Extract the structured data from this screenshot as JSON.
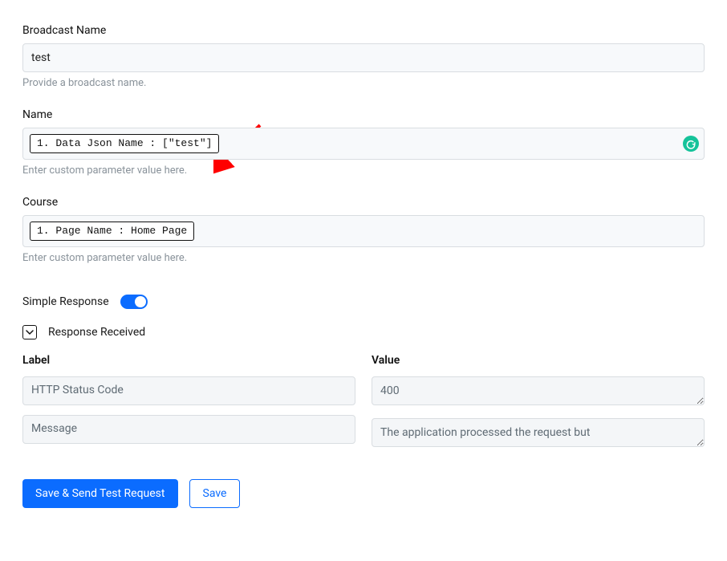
{
  "broadcast": {
    "label": "Broadcast Name",
    "value": "test",
    "help": "Provide a broadcast name."
  },
  "nameField": {
    "label": "Name",
    "tag": "1. Data Json Name : [\"test\"]",
    "help": "Enter custom parameter value here."
  },
  "courseField": {
    "label": "Course",
    "tag": "1. Page Name : Home Page",
    "help": "Enter custom parameter value here."
  },
  "simpleResponse": {
    "label": "Simple Response",
    "toggle_on": true,
    "responseReceived": "Response Received"
  },
  "table": {
    "labelHeader": "Label",
    "valueHeader": "Value",
    "rows": [
      {
        "label": "HTTP Status Code",
        "value": "400"
      },
      {
        "label": "Message",
        "value": "The application processed the request but"
      }
    ]
  },
  "buttons": {
    "saveSend": "Save & Send Test Request",
    "save": "Save"
  }
}
